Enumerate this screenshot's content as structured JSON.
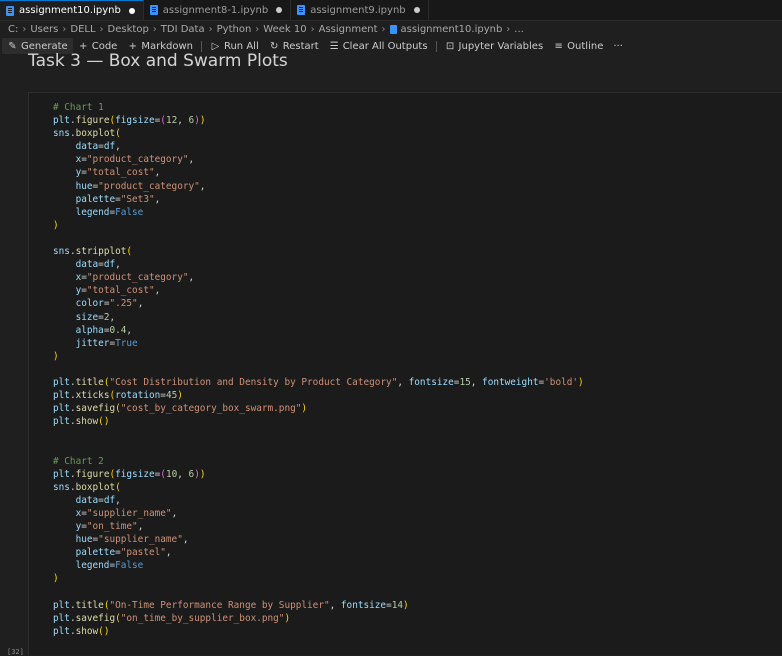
{
  "tabs": [
    {
      "label": "assignment10.ipynb",
      "active": true,
      "icon": "notebook-icon",
      "modified": true
    },
    {
      "label": "assignment8-1.ipynb",
      "active": false,
      "icon": "notebook-icon",
      "modified": true
    },
    {
      "label": "assignment9.ipynb",
      "active": false,
      "icon": "notebook-icon",
      "modified": true
    }
  ],
  "breadcrumb": [
    "C:",
    "Users",
    "DELL",
    "Desktop",
    "TDI Data",
    "Python",
    "Week 10",
    "Assignment",
    "assignment10.ipynb",
    "..."
  ],
  "toolbar": {
    "generate": "Generate",
    "code": "Code",
    "markdown": "Markdown",
    "run_all": "Run All",
    "restart": "Restart",
    "clear_all_outputs": "Clear All Outputs",
    "jupyter_variables": "Jupyter Variables",
    "outline": "Outline",
    "more": "···"
  },
  "markdown_heading": "Task 3 — Box and Swarm Plots",
  "cell": {
    "execution_count": "[32]",
    "lines": [
      [
        [
          "cm",
          "# Chart 1"
        ]
      ],
      [
        [
          "var",
          "plt"
        ],
        [
          "pl",
          "."
        ],
        [
          "fn",
          "figure"
        ],
        [
          "br",
          "("
        ],
        [
          "var",
          "figsize"
        ],
        [
          "pl",
          "="
        ],
        [
          "br2",
          "("
        ],
        [
          "num",
          "12"
        ],
        [
          "pl",
          ", "
        ],
        [
          "num",
          "6"
        ],
        [
          "br2",
          ")"
        ],
        [
          "br",
          ")"
        ]
      ],
      [
        [
          "var",
          "sns"
        ],
        [
          "pl",
          "."
        ],
        [
          "fn",
          "boxplot"
        ],
        [
          "br",
          "("
        ]
      ],
      [
        [
          "pl",
          "    "
        ],
        [
          "var",
          "data"
        ],
        [
          "pl",
          "="
        ],
        [
          "var",
          "df"
        ],
        [
          "pl",
          ","
        ]
      ],
      [
        [
          "pl",
          "    "
        ],
        [
          "var",
          "x"
        ],
        [
          "pl",
          "="
        ],
        [
          "str",
          "\"product_category\""
        ],
        [
          "pl",
          ","
        ]
      ],
      [
        [
          "pl",
          "    "
        ],
        [
          "var",
          "y"
        ],
        [
          "pl",
          "="
        ],
        [
          "str",
          "\"total_cost\""
        ],
        [
          "pl",
          ","
        ]
      ],
      [
        [
          "pl",
          "    "
        ],
        [
          "var",
          "hue"
        ],
        [
          "pl",
          "="
        ],
        [
          "str",
          "\"product_category\""
        ],
        [
          "pl",
          ","
        ]
      ],
      [
        [
          "pl",
          "    "
        ],
        [
          "var",
          "palette"
        ],
        [
          "pl",
          "="
        ],
        [
          "str",
          "\"Set3\""
        ],
        [
          "pl",
          ","
        ]
      ],
      [
        [
          "pl",
          "    "
        ],
        [
          "var",
          "legend"
        ],
        [
          "pl",
          "="
        ],
        [
          "kw",
          "False"
        ]
      ],
      [
        [
          "br",
          ")"
        ]
      ],
      [],
      [
        [
          "var",
          "sns"
        ],
        [
          "pl",
          "."
        ],
        [
          "fn",
          "stripplot"
        ],
        [
          "br",
          "("
        ]
      ],
      [
        [
          "pl",
          "    "
        ],
        [
          "var",
          "data"
        ],
        [
          "pl",
          "="
        ],
        [
          "var",
          "df"
        ],
        [
          "pl",
          ","
        ]
      ],
      [
        [
          "pl",
          "    "
        ],
        [
          "var",
          "x"
        ],
        [
          "pl",
          "="
        ],
        [
          "str",
          "\"product_category\""
        ],
        [
          "pl",
          ","
        ]
      ],
      [
        [
          "pl",
          "    "
        ],
        [
          "var",
          "y"
        ],
        [
          "pl",
          "="
        ],
        [
          "str",
          "\"total_cost\""
        ],
        [
          "pl",
          ","
        ]
      ],
      [
        [
          "pl",
          "    "
        ],
        [
          "var",
          "color"
        ],
        [
          "pl",
          "="
        ],
        [
          "str",
          "\".25\""
        ],
        [
          "pl",
          ","
        ]
      ],
      [
        [
          "pl",
          "    "
        ],
        [
          "var",
          "size"
        ],
        [
          "pl",
          "="
        ],
        [
          "num",
          "2"
        ],
        [
          "pl",
          ","
        ]
      ],
      [
        [
          "pl",
          "    "
        ],
        [
          "var",
          "alpha"
        ],
        [
          "pl",
          "="
        ],
        [
          "num",
          "0.4"
        ],
        [
          "pl",
          ","
        ]
      ],
      [
        [
          "pl",
          "    "
        ],
        [
          "var",
          "jitter"
        ],
        [
          "pl",
          "="
        ],
        [
          "kw",
          "True"
        ]
      ],
      [
        [
          "br",
          ")"
        ]
      ],
      [],
      [
        [
          "var",
          "plt"
        ],
        [
          "pl",
          "."
        ],
        [
          "fn",
          "title"
        ],
        [
          "br",
          "("
        ],
        [
          "str",
          "\"Cost Distribution and Density by Product Category\""
        ],
        [
          "pl",
          ", "
        ],
        [
          "var",
          "fontsize"
        ],
        [
          "pl",
          "="
        ],
        [
          "num",
          "15"
        ],
        [
          "pl",
          ", "
        ],
        [
          "var",
          "fontweight"
        ],
        [
          "pl",
          "="
        ],
        [
          "str",
          "'bold'"
        ],
        [
          "br",
          ")"
        ]
      ],
      [
        [
          "var",
          "plt"
        ],
        [
          "pl",
          "."
        ],
        [
          "fn",
          "xticks"
        ],
        [
          "br",
          "("
        ],
        [
          "var",
          "rotation"
        ],
        [
          "pl",
          "="
        ],
        [
          "num",
          "45"
        ],
        [
          "br",
          ")"
        ]
      ],
      [
        [
          "var",
          "plt"
        ],
        [
          "pl",
          "."
        ],
        [
          "fn",
          "savefig"
        ],
        [
          "br",
          "("
        ],
        [
          "str",
          "\"cost_by_category_box_swarm.png\""
        ],
        [
          "br",
          ")"
        ]
      ],
      [
        [
          "var",
          "plt"
        ],
        [
          "pl",
          "."
        ],
        [
          "fn",
          "show"
        ],
        [
          "br",
          "("
        ],
        [
          "br",
          ")"
        ]
      ],
      [],
      [],
      [
        [
          "cm",
          "# Chart 2"
        ]
      ],
      [
        [
          "var",
          "plt"
        ],
        [
          "pl",
          "."
        ],
        [
          "fn",
          "figure"
        ],
        [
          "br",
          "("
        ],
        [
          "var",
          "figsize"
        ],
        [
          "pl",
          "="
        ],
        [
          "br2",
          "("
        ],
        [
          "num",
          "10"
        ],
        [
          "pl",
          ", "
        ],
        [
          "num",
          "6"
        ],
        [
          "br2",
          ")"
        ],
        [
          "br",
          ")"
        ]
      ],
      [
        [
          "var",
          "sns"
        ],
        [
          "pl",
          "."
        ],
        [
          "fn",
          "boxplot"
        ],
        [
          "br",
          "("
        ]
      ],
      [
        [
          "pl",
          "    "
        ],
        [
          "var",
          "data"
        ],
        [
          "pl",
          "="
        ],
        [
          "var",
          "df"
        ],
        [
          "pl",
          ","
        ]
      ],
      [
        [
          "pl",
          "    "
        ],
        [
          "var",
          "x"
        ],
        [
          "pl",
          "="
        ],
        [
          "str",
          "\"supplier_name\""
        ],
        [
          "pl",
          ","
        ]
      ],
      [
        [
          "pl",
          "    "
        ],
        [
          "var",
          "y"
        ],
        [
          "pl",
          "="
        ],
        [
          "str",
          "\"on_time\""
        ],
        [
          "pl",
          ","
        ]
      ],
      [
        [
          "pl",
          "    "
        ],
        [
          "var",
          "hue"
        ],
        [
          "pl",
          "="
        ],
        [
          "str",
          "\"supplier_name\""
        ],
        [
          "pl",
          ","
        ]
      ],
      [
        [
          "pl",
          "    "
        ],
        [
          "var",
          "palette"
        ],
        [
          "pl",
          "="
        ],
        [
          "str",
          "\"pastel\""
        ],
        [
          "pl",
          ","
        ]
      ],
      [
        [
          "pl",
          "    "
        ],
        [
          "var",
          "legend"
        ],
        [
          "pl",
          "="
        ],
        [
          "kw",
          "False"
        ]
      ],
      [
        [
          "br",
          ")"
        ]
      ],
      [],
      [
        [
          "var",
          "plt"
        ],
        [
          "pl",
          "."
        ],
        [
          "fn",
          "title"
        ],
        [
          "br",
          "("
        ],
        [
          "str",
          "\"On-Time Performance Range by Supplier\""
        ],
        [
          "pl",
          ", "
        ],
        [
          "var",
          "fontsize"
        ],
        [
          "pl",
          "="
        ],
        [
          "num",
          "14"
        ],
        [
          "br",
          ")"
        ]
      ],
      [
        [
          "var",
          "plt"
        ],
        [
          "pl",
          "."
        ],
        [
          "fn",
          "savefig"
        ],
        [
          "br",
          "("
        ],
        [
          "str",
          "\"on_time_by_supplier_box.png\""
        ],
        [
          "br",
          ")"
        ]
      ],
      [
        [
          "var",
          "plt"
        ],
        [
          "pl",
          "."
        ],
        [
          "fn",
          "show"
        ],
        [
          "br",
          "("
        ],
        [
          "br",
          ")"
        ]
      ]
    ]
  }
}
